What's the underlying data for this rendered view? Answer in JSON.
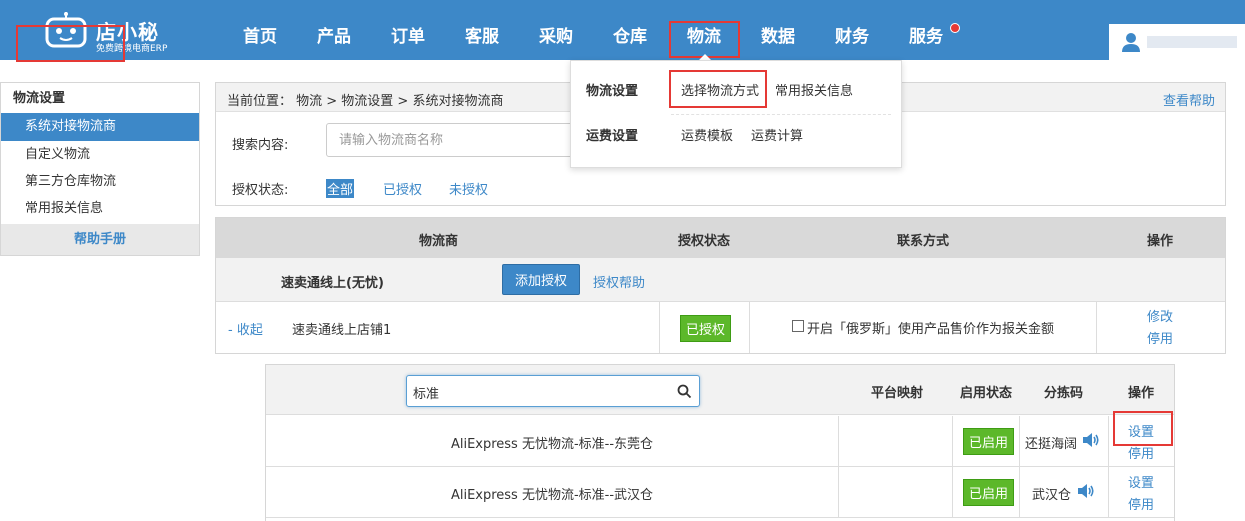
{
  "brand": {
    "name": "店小秘",
    "tagline": "免费跨境电商ERP"
  },
  "nav": {
    "items": [
      "首页",
      "产品",
      "订单",
      "客服",
      "采购",
      "仓库",
      "物流",
      "数据",
      "财务",
      "服务"
    ],
    "active": "物流"
  },
  "sidebar": {
    "title": "物流设置",
    "items": [
      "系统对接物流商",
      "自定义物流",
      "第三方仓库物流",
      "常用报关信息"
    ],
    "active": "系统对接物流商",
    "help": "帮助手册"
  },
  "breadcrumb": {
    "text": "当前位置：  物流 >  物流设置 > 系统对接物流商",
    "help_link": "查看帮助"
  },
  "filters": {
    "search_label": "搜索内容:",
    "search_placeholder": "请输入物流商名称",
    "auth_label": "授权状态:",
    "auth_options": [
      "全部",
      "已授权",
      "未授权"
    ],
    "auth_selected": "全部"
  },
  "dropdown": {
    "groups": [
      {
        "heading": "物流设置",
        "items": [
          "选择物流方式",
          "常用报关信息"
        ]
      },
      {
        "heading": "运费设置",
        "items": [
          "运费模板",
          "运费计算"
        ]
      }
    ]
  },
  "logistics_table": {
    "headers": [
      "物流商",
      "授权状态",
      "联系方式",
      "操作"
    ],
    "carrier": {
      "name": "速卖通线上(无忧)",
      "add_button": "添加授权",
      "help_link": "授权帮助"
    },
    "store": {
      "toggle": "- 收起",
      "name": "速卖通线上店铺1",
      "status": "已授权",
      "checkbox_label": "开启「俄罗斯」使用产品售价作为报关金额",
      "checkbox_checked": false,
      "actions": [
        "修改",
        "停用"
      ]
    }
  },
  "service_table": {
    "search_value": "标准",
    "headers": [
      "平台映射",
      "启用状态",
      "分拣码",
      "操作"
    ],
    "rows": [
      {
        "name": "AliExpress 无忧物流-标准--东莞仓",
        "status": "已启用",
        "sort_code": "还挺海阔",
        "actions": [
          "设置",
          "停用"
        ]
      },
      {
        "name": "AliExpress 无忧物流-标准--武汉仓",
        "status": "已启用",
        "sort_code": "武汉仓",
        "actions": [
          "设置",
          "停用"
        ]
      }
    ]
  },
  "colors": {
    "primary": "#3d88c8",
    "success": "#5cb82a",
    "highlight": "#e53935"
  }
}
